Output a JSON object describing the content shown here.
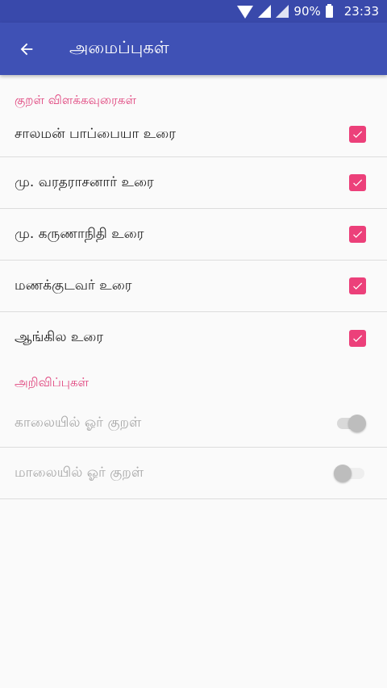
{
  "status_bar": {
    "battery": "90%",
    "time": "23:33"
  },
  "app_bar": {
    "title": "அமைப்புகள்"
  },
  "sections": {
    "commentaries": {
      "header": "குறள் விளக்கவுரைகள்",
      "items": [
        {
          "label": "சாலமன் பாப்பையா உரை",
          "checked": true
        },
        {
          "label": "மு. வரதராசனார் உரை",
          "checked": true
        },
        {
          "label": "மு. கருணாநிதி உரை",
          "checked": true
        },
        {
          "label": "மணக்குடவர் உரை",
          "checked": true
        },
        {
          "label": "ஆங்கில உரை",
          "checked": true
        }
      ]
    },
    "notifications": {
      "header": "அறிவிப்புகள்",
      "items": [
        {
          "label": "காலையில் ஓர் குறள்",
          "on": true,
          "enabled": false
        },
        {
          "label": "மாலையில் ஓர் குறள்",
          "on": false,
          "enabled": false
        }
      ]
    }
  },
  "colors": {
    "primary": "#3f51b5",
    "status_bar": "#3949ab",
    "accent": "#ec407a"
  }
}
